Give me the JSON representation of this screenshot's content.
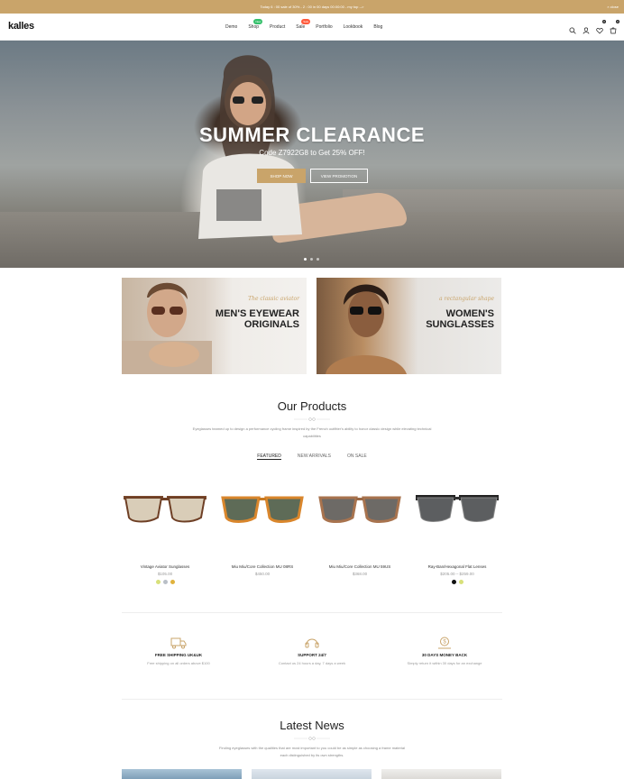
{
  "topbar": {
    "text": "Today 6 : 00 sale of 30% - 2 : 00 in 00 days 00:00:00 - my top -->",
    "close": "× close"
  },
  "header": {
    "logo": "kalles",
    "nav": [
      {
        "label": "Demo"
      },
      {
        "label": "Shop",
        "badge": "New"
      },
      {
        "label": "Product"
      },
      {
        "label": "Sale",
        "badge": "Sale"
      },
      {
        "label": "Portfolio"
      },
      {
        "label": "Lookbook"
      },
      {
        "label": "Blog"
      }
    ],
    "wishlist_count": "0",
    "cart_count": "0"
  },
  "hero": {
    "title": "SUMMER CLEARANCE",
    "subtitle": "Code Z7922G8 to Get 25% OFF!",
    "btn_shop": "SHOP NOW",
    "btn_promo": "VIEW PROMOTION",
    "slide_count": 3,
    "active_slide": 1
  },
  "banners": {
    "men": {
      "script": "The classic aviator",
      "title_1": "MEN'S EYEWEAR",
      "title_2": "ORIGINALS"
    },
    "women": {
      "script": "a rectangular shape",
      "title_1": "WOMEN'S",
      "title_2": "SUNGLASSES"
    }
  },
  "products_section": {
    "title": "Our Products",
    "desc": "Eyeglasses teamed up to design a performance cycling frame inspired by the French outfitter's ability to honor classic design while elevating technical capabilities",
    "tabs": [
      "FEATURED",
      "NEW ARRIVALS",
      "ON SALE"
    ],
    "active_tab": 0
  },
  "products": [
    {
      "name": "Vintage Aviator Sunglasses",
      "price": "$105.00",
      "swatches": [
        "#d8e07a",
        "#b9bfc7",
        "#e0b23c"
      ]
    },
    {
      "name": "Miu Miu/Core Collection MU 08RS",
      "price": "$450.00",
      "swatches": []
    },
    {
      "name": "Miu Miu/Core Collection MU 59US",
      "price": "$368.00",
      "swatches": []
    },
    {
      "name": "Ray-Ban/Hexagonal Flat Lenses",
      "price": "$205.00 – $259.00",
      "swatches": [
        "#111111",
        "#d8e07a"
      ]
    }
  ],
  "features": [
    {
      "title": "FREE SHIPPING UK&UK",
      "desc": "Free shipping on all orders above $100",
      "icon": "truck-icon"
    },
    {
      "title": "SUPPORT 24/7",
      "desc": "Contact us 24 hours a day, 7 days a week",
      "icon": "headset-icon"
    },
    {
      "title": "30 DAYS MONEY BACK",
      "desc": "Simply return it within 30 days for an exchange",
      "icon": "money-back-icon"
    }
  ],
  "news_section": {
    "title": "Latest News",
    "desc_1": "Finding eyeglasses with the qualities that are most important to you could be as simple as choosing a frame material",
    "desc_2": "each distinguished by its own strengths."
  },
  "colors": {
    "accent": "#c9a46a",
    "badge_new": "#35c06b",
    "badge_sale": "#ff5a3c"
  }
}
